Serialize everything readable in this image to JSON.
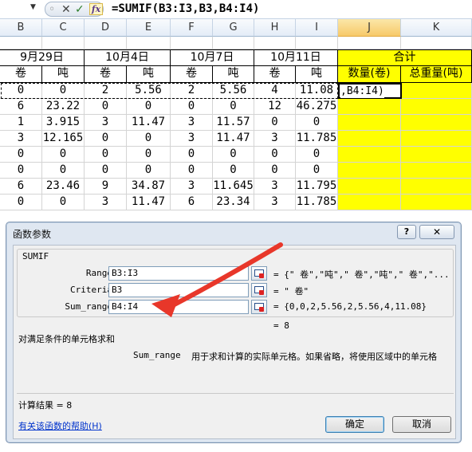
{
  "formula_bar": {
    "formula": "=SUMIF(B3:I3,B3,B4:I4)",
    "cancel_icon": "✕",
    "enter_icon": "✓",
    "fx_icon": "fx"
  },
  "columns": [
    "B",
    "C",
    "D",
    "E",
    "F",
    "G",
    "H",
    "I",
    "J",
    "K"
  ],
  "header_row": {
    "d1": "9月29日",
    "d2": "10月4日",
    "d3": "10月7日",
    "d4": "10月11日",
    "total": "合计"
  },
  "subheader_row": [
    "卷",
    "吨",
    "卷",
    "吨",
    "卷",
    "吨",
    "卷",
    "吨",
    "数量(卷)",
    "总重量(吨)"
  ],
  "rows": [
    [
      "0",
      "0",
      "2",
      "5.56",
      "2",
      "5.56",
      "4",
      "11.08"
    ],
    [
      "6",
      "23.22",
      "0",
      "0",
      "0",
      "0",
      "12",
      "46.275"
    ],
    [
      "1",
      "3.915",
      "3",
      "11.47",
      "3",
      "11.57",
      "0",
      "0"
    ],
    [
      "3",
      "12.165",
      "0",
      "0",
      "3",
      "11.47",
      "3",
      "11.785"
    ],
    [
      "0",
      "0",
      "0",
      "0",
      "0",
      "0",
      "0",
      "0"
    ],
    [
      "0",
      "0",
      "0",
      "0",
      "0",
      "0",
      "0",
      "0"
    ],
    [
      "6",
      "23.46",
      "9",
      "34.87",
      "3",
      "11.645",
      "3",
      "11.795"
    ],
    [
      "0",
      "0",
      "3",
      "11.47",
      "6",
      "23.34",
      "3",
      "11.785"
    ]
  ],
  "active_cell_text": ",B4:I4)",
  "dialog": {
    "title": "函数参数",
    "help_button": "?",
    "close_button": "✕",
    "function_name": "SUMIF",
    "args": [
      {
        "name": "Range",
        "value": "B3:I3",
        "result": "= {\" 卷\",\"吨\",\" 卷\",\"吨\",\" 卷\",\"..."
      },
      {
        "name": "Criteria",
        "value": "B3",
        "result": "= \" 卷\""
      },
      {
        "name": "Sum_range",
        "value": "B4:I4",
        "result": "= {0,0,2,5.56,2,5.56,4,11.08}"
      }
    ],
    "total_result": "= 8",
    "description": "对满足条件的单元格求和",
    "arg_help_name": "Sum_range",
    "arg_help_text": "用于求和计算的实际单元格。如果省略，将使用区域中的单元格",
    "calc_result": "计算结果 = 8",
    "help_link": "有关该函数的帮助(H)",
    "ok": "确定",
    "cancel": "取消"
  },
  "colors": {
    "highlight": "#ffff00",
    "arrow": "#e8372a",
    "link": "#0033cc"
  }
}
